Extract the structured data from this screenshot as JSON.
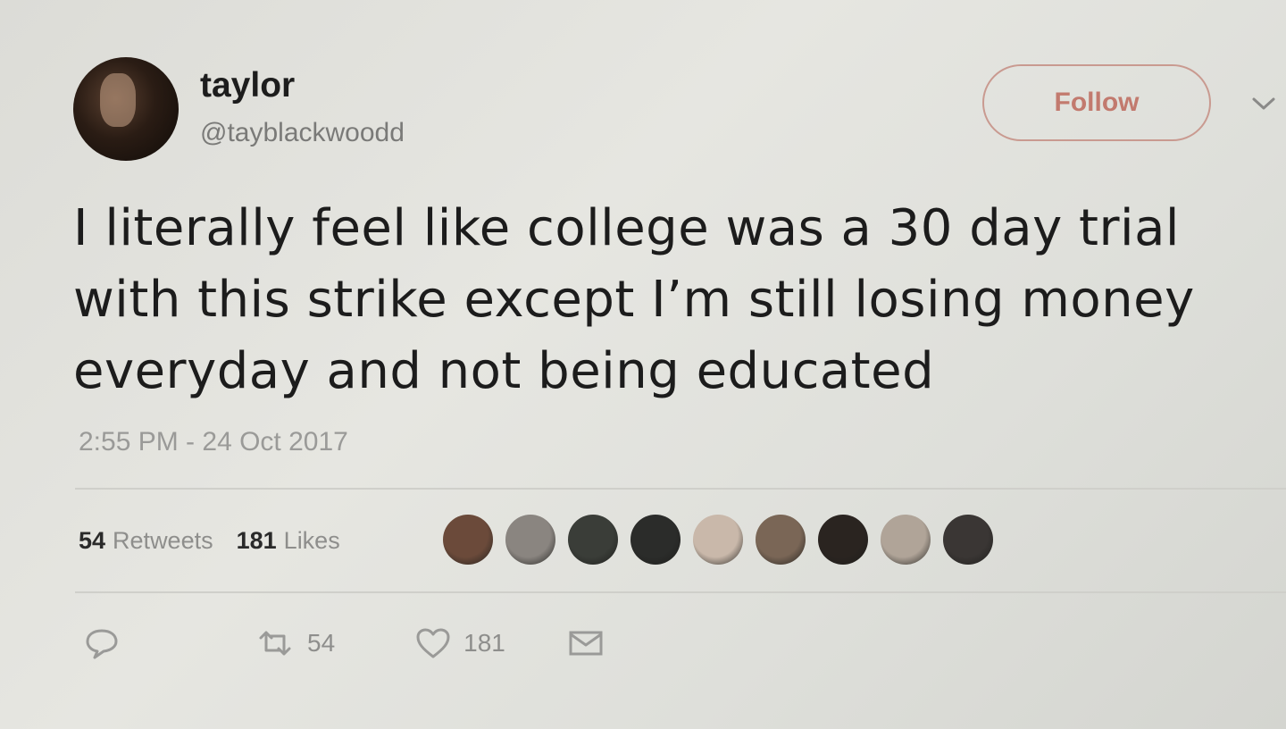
{
  "author": {
    "display_name": "taylor",
    "handle": "@tayblackwoodd"
  },
  "follow_label": "Follow",
  "tweet": {
    "lines": [
      "I literally feel like college was a 30 day trial",
      "with this strike except I’m still losing money",
      "everyday and not being educated"
    ],
    "timestamp": "2:55 PM - 24 Oct 2017"
  },
  "stats": {
    "retweets_count": "54",
    "retweets_label": "Retweets",
    "likes_count": "181",
    "likes_label": "Likes"
  },
  "likers": [
    {
      "color": "#6b4a3a"
    },
    {
      "color": "#8a8580"
    },
    {
      "color": "#3a3d38"
    },
    {
      "color": "#2b2c2a"
    },
    {
      "color": "#c9b8aa"
    },
    {
      "color": "#7a6656"
    },
    {
      "color": "#2a2420"
    },
    {
      "color": "#b0a498"
    },
    {
      "color": "#3a3634"
    }
  ],
  "actions": {
    "reply_icon": "reply-icon",
    "retweet_icon": "retweet-icon",
    "retweet_count": "54",
    "like_icon": "heart-icon",
    "like_count": "181",
    "message_icon": "envelope-icon"
  },
  "colors": {
    "follow_accent": "#c27a6e",
    "muted_text": "#8e8e8c"
  }
}
